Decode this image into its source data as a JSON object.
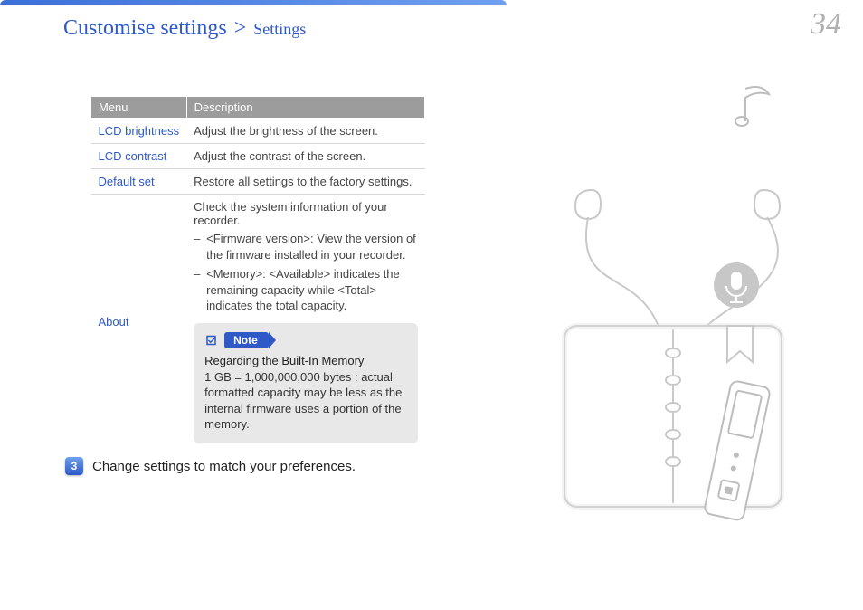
{
  "breadcrumb": {
    "section": "Customise settings",
    "separator": ">",
    "sub": "Settings"
  },
  "page_number": "34",
  "table": {
    "headers": {
      "menu": "Menu",
      "description": "Description"
    },
    "rows": [
      {
        "menu": "LCD brightness",
        "desc": "Adjust the brightness of the screen."
      },
      {
        "menu": "LCD contrast",
        "desc": "Adjust the contrast of the screen."
      },
      {
        "menu": "Default set",
        "desc": "Restore all settings to the factory settings."
      }
    ],
    "about": {
      "menu": "About",
      "intro": "Check the system information of your recorder.",
      "items": [
        "<Firmware version>: View the version of the firmware installed in your recorder.",
        "<Memory>: <Available> indicates the remaining capacity while <Total> indicates the total capacity."
      ]
    }
  },
  "note": {
    "label": "Note",
    "title": "Regarding the Built-In Memory",
    "body": "1 GB = 1,000,000,000 bytes : actual formatted capacity may be less as the internal firmware uses a portion of the memory."
  },
  "step": {
    "number": "3",
    "text": "Change settings to match your preferences."
  },
  "icons": {
    "music": "music-note-icon",
    "mic": "microphone-icon"
  }
}
